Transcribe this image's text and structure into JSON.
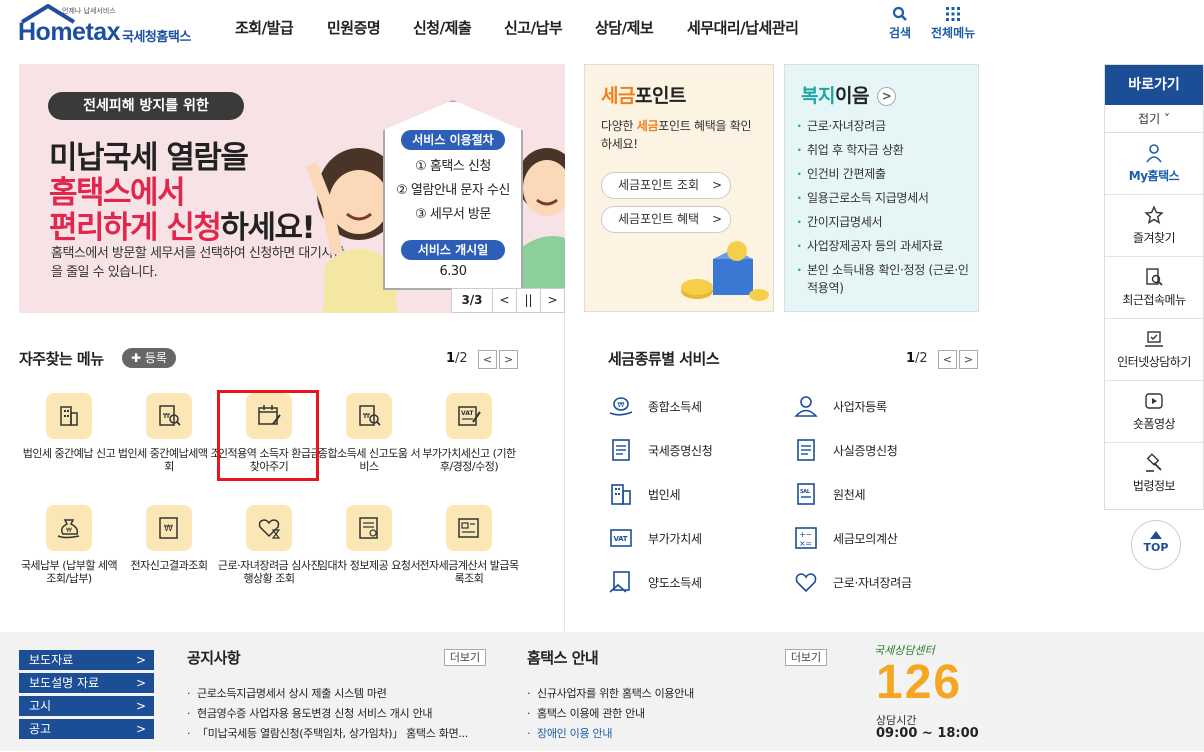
{
  "header": {
    "logo_small": "언제나 납세서비스",
    "logo_home": "Hometax",
    "logo_ko": "국세청홈택스",
    "nav": [
      "조회/발급",
      "민원증명",
      "신청/제출",
      "신고/납부",
      "상담/제보",
      "세무대리/납세관리"
    ],
    "search_label": "검색",
    "menu_label": "전체메뉴"
  },
  "banner": {
    "pill": "전세피해 방지를 위한",
    "line1": "미납국세 열람을",
    "line2": "홈택스에서",
    "line3_red": "편리하게 신청",
    "line3_black": "하세요!",
    "desc": "홈택스에서 방문할 세무서를 선택하여 신청하면 대기시간을 줄일 수 있습니다.",
    "process_label": "서비스 이용절차",
    "steps": [
      "① 홈택스 신청",
      "② 열람안내 문자 수신",
      "③ 세무서 방문"
    ],
    "start_label": "서비스 개시일",
    "start_date": "6.30",
    "page": "3/3",
    "prev": "<",
    "pause": "||",
    "next": ">"
  },
  "tax_point": {
    "title_a": "세금",
    "title_b": "포인트",
    "desc_a": "다양한 ",
    "desc_b": "세금",
    "desc_c": "포인트 혜택을 확인하세요!",
    "btn1": "세금포인트 조회",
    "btn2": "세금포인트 혜택",
    "chevron": ">"
  },
  "welfare": {
    "title_a": "복지",
    "title_b": "이음",
    "items": [
      "근로·자녀장려금",
      "취업 후 학자금 상환",
      "인건비 간편제출",
      "일용근로소득 지급명세서",
      "간이지급명세서",
      "사업장제공자 등의 과세자료",
      "본인 소득내용 확인·정정 (근로·인적용역)"
    ]
  },
  "frequent": {
    "title": "자주찾는 메뉴",
    "register": "✚ 등록",
    "page_cur": "1",
    "page_total": "/2",
    "items": [
      "법인세 중간예납 신고",
      "법인세 중간예납세액 조회",
      "인적용역 소득자 환급금 찾아주기",
      "종합소득세 신고도움 서비스",
      "부가가치세신고 (기한후/경정/수정)",
      "국세납부 (납부할 세액 조회/납부)",
      "전자신고결과조회",
      "근로·자녀장려금 심사진행상황 조회",
      "임대차 정보제공 요청서",
      "전자세금계산서 발급목록조회"
    ]
  },
  "tax_types": {
    "title": "세금종류별 서비스",
    "page_cur": "1",
    "page_total": "/2",
    "items": [
      "종합소득세",
      "사업자등록",
      "국세증명신청",
      "사실증명신청",
      "법인세",
      "원천세",
      "부가가치세",
      "세금모의계산",
      "양도소득세",
      "근로·자녀장려금"
    ]
  },
  "quick": {
    "title": "바로가기",
    "fold": "접기 ˅",
    "items": [
      "My홈택스",
      "즐겨찾기",
      "최근접속메뉴",
      "인터넷상담하기",
      "숏폼영상",
      "법령정보"
    ],
    "top": "TOP"
  },
  "footer": {
    "buttons": [
      "보도자료",
      "보도설명 자료",
      "고시",
      "공고"
    ],
    "notice_title": "공지사항",
    "notice_more": "더보기",
    "notices": [
      "근로소득지급명세서 상시 제출 시스템 마련",
      "현금영수증 사업자용 용도변경 신청 서비스 개시 안내",
      "「미납국세등 열람신청(주택임차, 상가임차)」 홈택스 화면..."
    ],
    "guide_title": "홈택스 안내",
    "guide_more": "더보기",
    "guides": [
      "신규사업자를 위한 홈택스 이용안내",
      "홈택스 이용에 관한 안내",
      "장애인 이용 안내"
    ],
    "center_label": "국세상담센터",
    "center_number": "126",
    "hours_label": "상담시간",
    "hours": "09:00 ~ 18:00"
  },
  "colors": {
    "brand_blue": "#1c4e96",
    "accent_red": "#e2264d",
    "icon_bg": "#fbe7b6",
    "highlight": "#e8141e"
  }
}
